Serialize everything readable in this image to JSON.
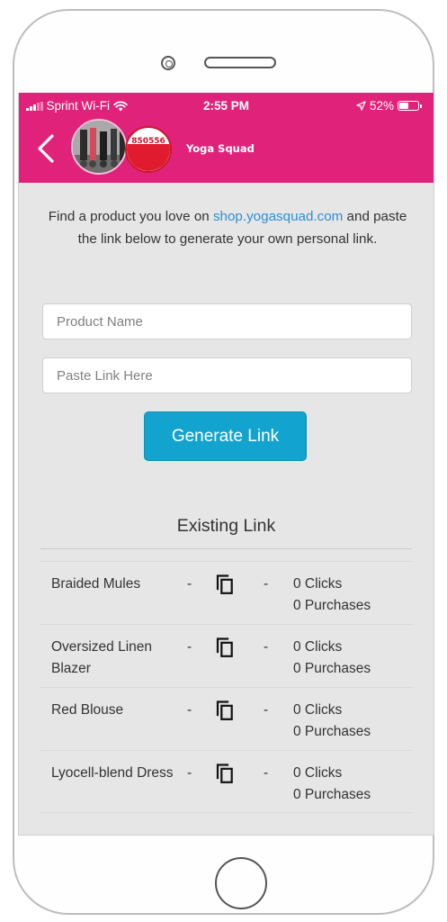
{
  "status_bar": {
    "carrier": "Sprint Wi-Fi",
    "time": "2:55 PM",
    "battery": "52%",
    "battery_level": 0.52
  },
  "header": {
    "group_name": "Yoga Squad",
    "badge_code": "850556",
    "color": "#e1227b"
  },
  "intro": {
    "before": "Find a product you love on ",
    "link": "shop.yogasquad.com",
    "after": " and paste the link below to generate your own personal link."
  },
  "form": {
    "product_name_placeholder": "Product Name",
    "link_placeholder": "Paste Link Here",
    "generate_label": "Generate Link",
    "button_color": "#12a4cf"
  },
  "existing": {
    "title": "Existing Link",
    "separator": "-",
    "links": [
      {
        "name": "Braided Mules",
        "clicks": "0 Clicks",
        "purchases": "0 Purchases"
      },
      {
        "name": "Oversized Linen Blazer",
        "clicks": "0 Clicks",
        "purchases": "0 Purchases"
      },
      {
        "name": "Red Blouse",
        "clicks": "0 Clicks",
        "purchases": "0 Purchases"
      },
      {
        "name": "Lyocell-blend Dress",
        "clicks": "0 Clicks",
        "purchases": "0 Purchases"
      }
    ]
  }
}
